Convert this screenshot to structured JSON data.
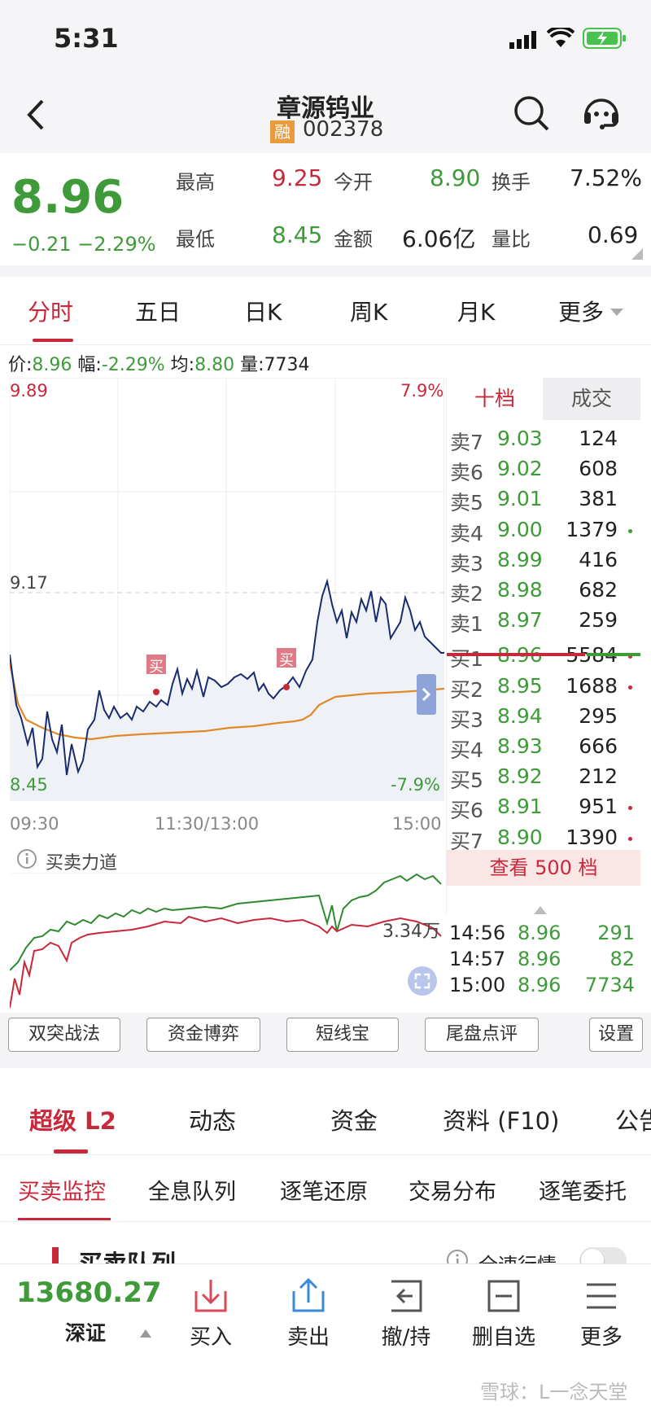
{
  "status": {
    "time": "5:31"
  },
  "nav": {
    "title": "章源钨业",
    "margin_badge": "融",
    "code": "002378"
  },
  "quote": {
    "price": "8.96",
    "change": "−0.21 −2.29%",
    "stats": [
      {
        "label": "最高",
        "value": "9.25"
      },
      {
        "label": "今开",
        "value": "8.90"
      },
      {
        "label": "换手",
        "value": "7.52%"
      },
      {
        "label": "最低",
        "value": "8.45"
      },
      {
        "label": "金额",
        "value": "6.06亿"
      },
      {
        "label": "量比",
        "value": "0.69"
      }
    ]
  },
  "tabs": [
    "分时",
    "五日",
    "日K",
    "周K",
    "月K",
    "更多"
  ],
  "info_line": {
    "price_label": "价:",
    "price": "8.96",
    "amp_label": "幅:",
    "amp": "-2.29%",
    "avg_label": "均:",
    "avg": "8.80",
    "vol_label": "量:",
    "vol": "7734"
  },
  "chart": {
    "y_high": "9.89",
    "y_mid": "9.17",
    "y_low": "8.45",
    "pct_high": "7.9%",
    "pct_low": "-7.9%",
    "x_start": "09:30",
    "x_mid": "11:30/13:00",
    "x_end": "15:00",
    "buy_marker": "买",
    "force_title": "买卖力道",
    "force_value": "3.34万"
  },
  "book": {
    "tab_ten": "十档",
    "tab_trade": "成交",
    "sells": [
      {
        "label": "卖7",
        "price": "9.03",
        "vol": "124"
      },
      {
        "label": "卖6",
        "price": "9.02",
        "vol": "608"
      },
      {
        "label": "卖5",
        "price": "9.01",
        "vol": "381"
      },
      {
        "label": "卖4",
        "price": "9.00",
        "vol": "1379"
      },
      {
        "label": "卖3",
        "price": "8.99",
        "vol": "416"
      },
      {
        "label": "卖2",
        "price": "8.98",
        "vol": "682"
      },
      {
        "label": "卖1",
        "price": "8.97",
        "vol": "259"
      }
    ],
    "buys": [
      {
        "label": "买1",
        "price": "8.96",
        "vol": "5584"
      },
      {
        "label": "买2",
        "price": "8.95",
        "vol": "1688"
      },
      {
        "label": "买3",
        "price": "8.94",
        "vol": "295"
      },
      {
        "label": "买4",
        "price": "8.93",
        "vol": "666"
      },
      {
        "label": "买5",
        "price": "8.92",
        "vol": "212"
      },
      {
        "label": "买6",
        "price": "8.91",
        "vol": "951"
      },
      {
        "label": "买7",
        "price": "8.90",
        "vol": "1390"
      }
    ],
    "view500": "查看 500 档",
    "trades": [
      {
        "time": "14:56",
        "price": "8.96",
        "vol": "291"
      },
      {
        "time": "14:57",
        "price": "8.96",
        "vol": "82"
      },
      {
        "time": "15:00",
        "price": "8.96",
        "vol": "7734"
      }
    ]
  },
  "tools": [
    "双突战法",
    "资金博弈",
    "短线宝",
    "尾盘点评",
    "设置"
  ],
  "section_tabs": [
    "超级 L2",
    "动态",
    "资金",
    "资料 (F10)",
    "公告"
  ],
  "sub_tabs": [
    "买卖监控",
    "全息队列",
    "逐笔还原",
    "交易分布",
    "逐笔委托"
  ],
  "queue": {
    "title": "买卖队列",
    "fullspeed": "全速行情"
  },
  "bottom": {
    "index_value": "13680.27",
    "index_name": "深证",
    "actions": [
      "买入",
      "卖出",
      "撤/持",
      "删自选",
      "更多"
    ]
  },
  "watermark": "雪球：L一念天堂",
  "colors": {
    "up": "#c8283a",
    "down": "#3f9b3a",
    "price_line": "#1a2c6b",
    "avg_line": "#e08a2a"
  }
}
